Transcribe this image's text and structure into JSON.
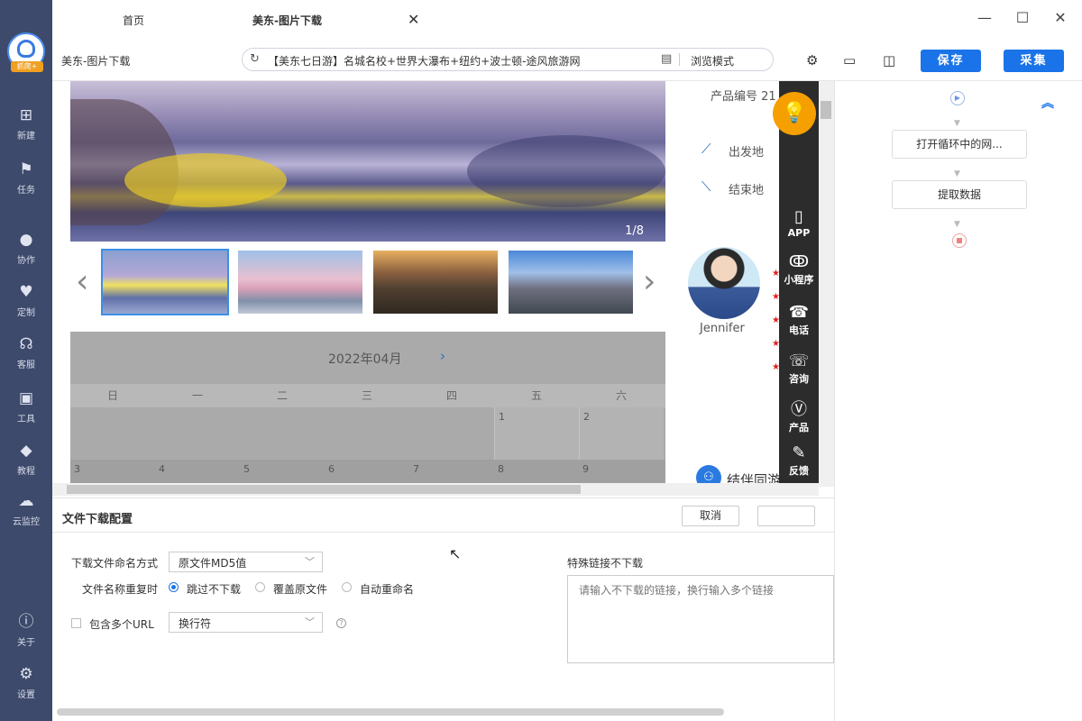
{
  "sidebar": {
    "logo_badge": "抓爬+",
    "items": [
      {
        "label": "新建",
        "icon": "plus-square-icon"
      },
      {
        "label": "任务",
        "icon": "flag-icon"
      },
      {
        "label": "协作",
        "icon": "people-icon"
      },
      {
        "label": "定制",
        "icon": "heart-check-icon"
      },
      {
        "label": "客服",
        "icon": "headset-icon"
      },
      {
        "label": "工具",
        "icon": "toolbox-icon"
      },
      {
        "label": "教程",
        "icon": "graduation-cap-icon"
      },
      {
        "label": "云监控",
        "icon": "cloud-monitor-icon"
      },
      {
        "label": "关于",
        "icon": "info-icon"
      },
      {
        "label": "设置",
        "icon": "gear-icon"
      }
    ]
  },
  "tabs": [
    {
      "label": "首页",
      "active": false
    },
    {
      "label": "美东-图片下载",
      "active": true
    }
  ],
  "toolbar": {
    "page_title": "美东-图片下载",
    "url": "【美东七日游】名城名校+世界大瀑布+纽约+波士顿-途风旅游网",
    "browse_mode": "浏览模式",
    "save_label": "保存",
    "collect_label": "采集"
  },
  "browser": {
    "image_counter": "1/8",
    "calendar": {
      "month": "2022年04月",
      "weekdays": [
        "日",
        "一",
        "二",
        "三",
        "四",
        "五",
        "六"
      ],
      "row1": [
        "",
        "",
        "",
        "",
        "",
        "1",
        "2"
      ],
      "row2": [
        "3",
        "4",
        "5",
        "6",
        "7",
        "8",
        "9"
      ]
    },
    "info": {
      "product_no": "产品编号 21",
      "departure": "出发地",
      "destination": "结束地",
      "guide_name": "Jennifer",
      "companion": "结伴同游"
    },
    "float_bar": [
      {
        "label": "APP",
        "icon": "phone-icon"
      },
      {
        "label": "小程序",
        "icon": "miniprogram-icon"
      },
      {
        "label": "电话",
        "icon": "telephone-icon"
      },
      {
        "label": "咨询",
        "icon": "chat-icon"
      },
      {
        "label": "产品",
        "icon": "vs-icon"
      },
      {
        "label": "反馈",
        "icon": "edit-icon"
      }
    ]
  },
  "workflow": {
    "steps": [
      "打开循环中的网...",
      "提取数据"
    ]
  },
  "config": {
    "title": "文件下载配置",
    "cancel_label": "取消",
    "naming_label": "下载文件命名方式",
    "naming_value": "原文件MD5值",
    "duplicate_label": "文件名称重复时",
    "dup_options": [
      "跳过不下载",
      "覆盖原文件",
      "自动重命名"
    ],
    "multi_url_label": "包含多个URL",
    "separator_value": "换行符",
    "skip_links_label": "特殊链接不下载",
    "skip_links_placeholder": "请输入不下载的链接，换行输入多个链接"
  }
}
